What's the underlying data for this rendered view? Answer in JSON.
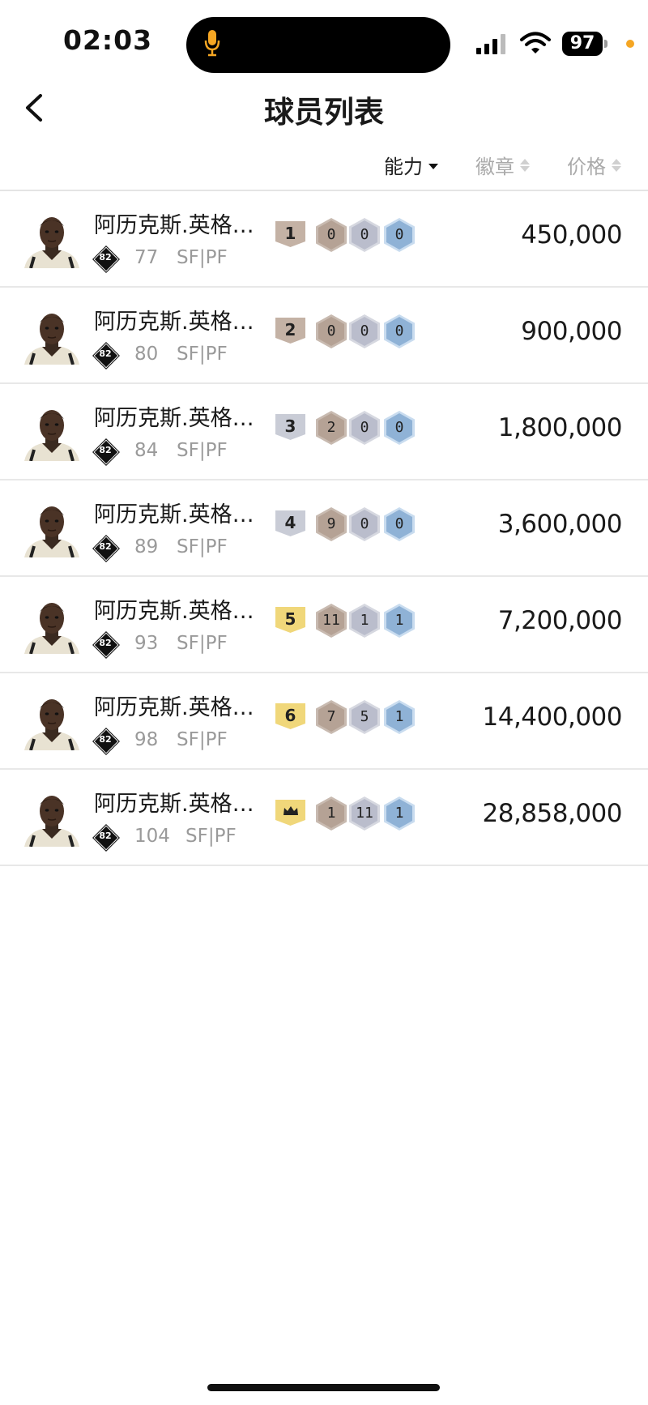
{
  "status_bar": {
    "time": "02:03",
    "battery": "97"
  },
  "header": {
    "title": "球员列表"
  },
  "sort": {
    "ability": "能力",
    "badge": "徽章",
    "price": "价格",
    "active": "ability"
  },
  "colors": {
    "level_bronze": "#c4b2a5",
    "level_silver": "#c9ccd6",
    "level_gold": "#f0d77a",
    "accent_orange": "#f5a623"
  },
  "players": [
    {
      "name": "阿历克斯.英格…",
      "ovr": "82",
      "rating": "77",
      "position": "SF|PF",
      "level": "1",
      "badge_bronze": "0",
      "badge_silver": "0",
      "badge_gold": "0",
      "price": "450,000"
    },
    {
      "name": "阿历克斯.英格…",
      "ovr": "82",
      "rating": "80",
      "position": "SF|PF",
      "level": "2",
      "badge_bronze": "0",
      "badge_silver": "0",
      "badge_gold": "0",
      "price": "900,000"
    },
    {
      "name": "阿历克斯.英格…",
      "ovr": "82",
      "rating": "84",
      "position": "SF|PF",
      "level": "3",
      "badge_bronze": "2",
      "badge_silver": "0",
      "badge_gold": "0",
      "price": "1,800,000"
    },
    {
      "name": "阿历克斯.英格…",
      "ovr": "82",
      "rating": "89",
      "position": "SF|PF",
      "level": "4",
      "badge_bronze": "9",
      "badge_silver": "0",
      "badge_gold": "0",
      "price": "3,600,000"
    },
    {
      "name": "阿历克斯.英格…",
      "ovr": "82",
      "rating": "93",
      "position": "SF|PF",
      "level": "5",
      "badge_bronze": "11",
      "badge_silver": "1",
      "badge_gold": "1",
      "price": "7,200,000"
    },
    {
      "name": "阿历克斯.英格…",
      "ovr": "82",
      "rating": "98",
      "position": "SF|PF",
      "level": "6",
      "badge_bronze": "7",
      "badge_silver": "5",
      "badge_gold": "1",
      "price": "14,400,000"
    },
    {
      "name": "阿历克斯.英格…",
      "ovr": "82",
      "rating": "104",
      "position": "SF|PF",
      "level": "crown-icon",
      "badge_bronze": "1",
      "badge_silver": "11",
      "badge_gold": "1",
      "price": "28,858,000"
    }
  ]
}
